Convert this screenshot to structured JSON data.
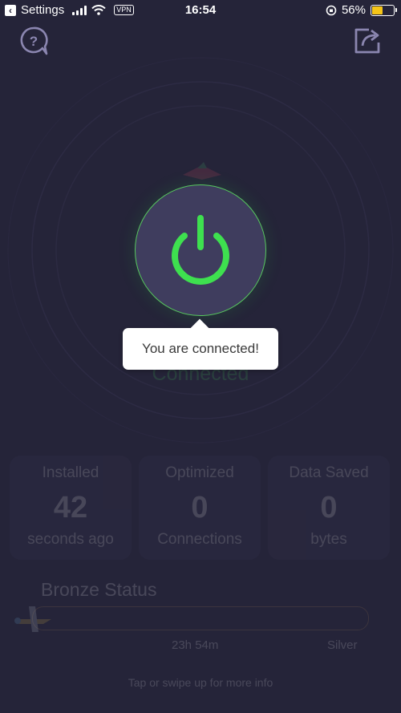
{
  "status_bar": {
    "back_app": "Settings",
    "vpn_badge": "VPN",
    "time": "16:54",
    "battery_percent": "56%",
    "battery_level": 0.56,
    "battery_color": "#f5c518"
  },
  "header": {
    "help_icon": "help-question-icon",
    "share_icon": "share-icon"
  },
  "power": {
    "state_label": "Connected",
    "accent_color": "#3ee04f"
  },
  "tooltip": {
    "text": "You are connected!"
  },
  "stats": [
    {
      "label": "Installed",
      "value": "42",
      "unit": "seconds ago"
    },
    {
      "label": "Optimized",
      "value": "0",
      "unit": "Connections"
    },
    {
      "label": "Data Saved",
      "value": "0",
      "unit": "bytes"
    }
  ],
  "status_progress": {
    "title": "Bronze Status",
    "time_remaining": "23h 54m",
    "next_level": "Silver",
    "progress_fraction": 0.0
  },
  "footer": {
    "hint": "Tap or swipe up for more info"
  }
}
